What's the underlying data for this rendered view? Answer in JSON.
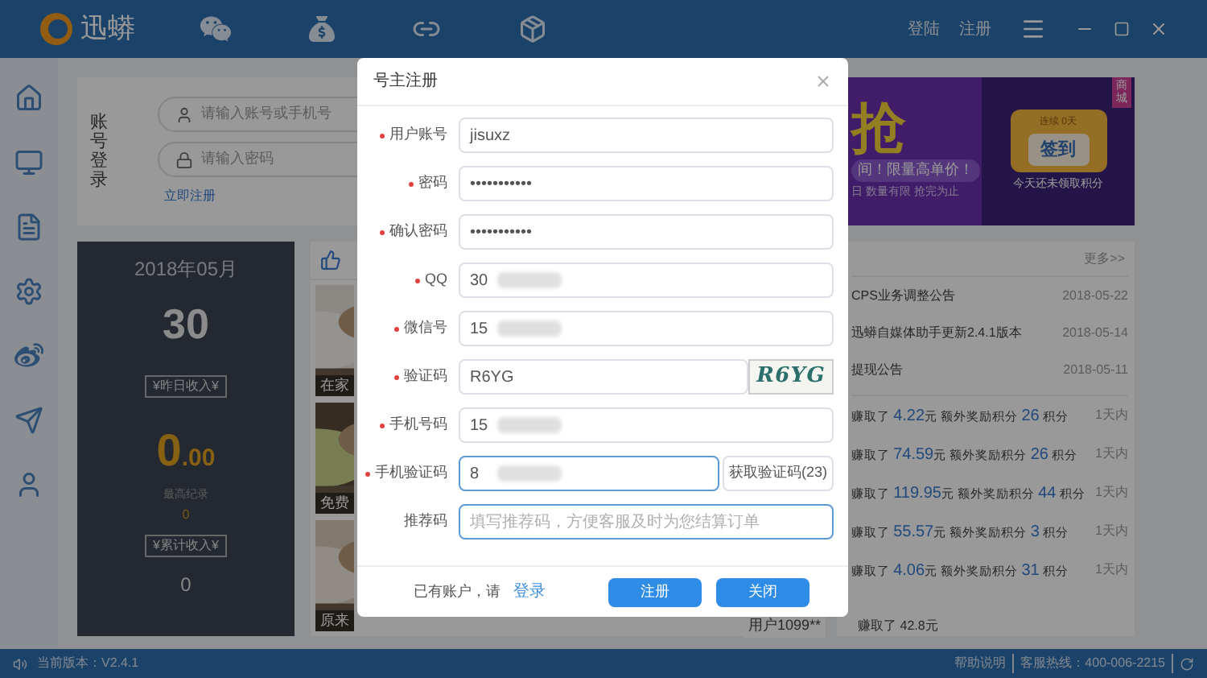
{
  "app": {
    "name": "迅蟒",
    "top_links": [
      {
        "label": "登陆"
      },
      {
        "label": "注册"
      }
    ]
  },
  "login_card": {
    "title": "账号登录",
    "account_placeholder": "请输入账号或手机号",
    "password_placeholder": "请输入密码",
    "register_link": "立即注册"
  },
  "banner": {
    "headline": "抢",
    "slogan": "间！限量高单价！",
    "note": "日 数量有限 抢完为止",
    "streak": "连续 0天",
    "sign_in_button": "签到",
    "sign_in_note": "今天还未领取积分",
    "tag": "商城"
  },
  "stats": {
    "month": "2018年05月",
    "day": "30",
    "yesterday_label": "¥昨日收入¥",
    "yesterday_int": "0",
    "yesterday_dec": ".00",
    "record_label": "最高纪录",
    "record_value": "0",
    "total_label": "¥累计收入¥",
    "total_value": "0"
  },
  "feed_cards": [
    {
      "caption": "在家"
    },
    {
      "caption": "免费"
    },
    {
      "caption": "原来"
    }
  ],
  "news": {
    "more": "更多>>",
    "items": [
      {
        "title": "CPS业务调整公告",
        "date": "2018-05-22"
      },
      {
        "title": "迅蟒自媒体助手更新2.4.1版本",
        "date": "2018-05-14"
      },
      {
        "title": "提现公告",
        "date": "2018-05-11"
      }
    ]
  },
  "earnings": [
    {
      "pre": "赚取了",
      "amount": "4.22",
      "mid": "元 额外奖励积分",
      "points": "26",
      "post": "积分",
      "time": "1天内"
    },
    {
      "pre": "赚取了",
      "amount": "74.59",
      "mid": "元 额外奖励积分",
      "points": "26",
      "post": "积分",
      "time": "1天内"
    },
    {
      "pre": "赚取了",
      "amount": "119.95",
      "mid": "元 额外奖励积分",
      "points": "44",
      "post": "积分",
      "time": "1天内"
    },
    {
      "pre": "赚取了",
      "amount": "55.57",
      "mid": "元 额外奖励积分",
      "points": "3",
      "post": "积分",
      "time": "1天内"
    },
    {
      "pre": "赚取了",
      "amount": "4.06",
      "mid": "元 额外奖励积分",
      "points": "31",
      "post": "积分",
      "time": "1天内"
    }
  ],
  "last_earning": {
    "user": "用户1099**",
    "text": "赚取了 42.8元"
  },
  "status_bar": {
    "version": "当前版本：V2.4.1",
    "help": "帮助说明",
    "hotline": "客服热线：400-006-2215"
  },
  "dialog": {
    "title": "号主注册",
    "fields": [
      {
        "kind": "text",
        "label": "用户账号",
        "required": true,
        "value": "jisuxz",
        "masked": false,
        "focused": false
      },
      {
        "kind": "text",
        "label": "密码",
        "required": true,
        "value": "•••••••••••",
        "masked": false,
        "focused": false
      },
      {
        "kind": "text",
        "label": "确认密码",
        "required": true,
        "value": "•••••••••••",
        "masked": false,
        "focused": false
      },
      {
        "kind": "text",
        "label": "QQ",
        "required": true,
        "value": "30",
        "masked": true,
        "focused": false
      },
      {
        "kind": "text",
        "label": "微信号",
        "required": true,
        "value": "15",
        "masked": true,
        "focused": false
      },
      {
        "kind": "captcha",
        "label": "验证码",
        "required": true,
        "value": "R6YG",
        "captcha": "R6YG",
        "masked": false,
        "focused": false
      },
      {
        "kind": "text",
        "label": "手机号码",
        "required": true,
        "value": "15",
        "masked": true,
        "focused": false
      },
      {
        "kind": "sms",
        "label": "手机验证码",
        "required": true,
        "value": "8",
        "button": "获取验证码(23)",
        "masked": true,
        "focused": true
      },
      {
        "kind": "text",
        "label": "推荐码",
        "required": false,
        "placeholder": "填写推荐码，方便客服及时为您结算订单",
        "masked": false,
        "focused": true
      }
    ],
    "footer_text": "已有账户，请",
    "login_link": "登录",
    "buttons": [
      {
        "label": "注册"
      },
      {
        "label": "关闭"
      }
    ]
  }
}
